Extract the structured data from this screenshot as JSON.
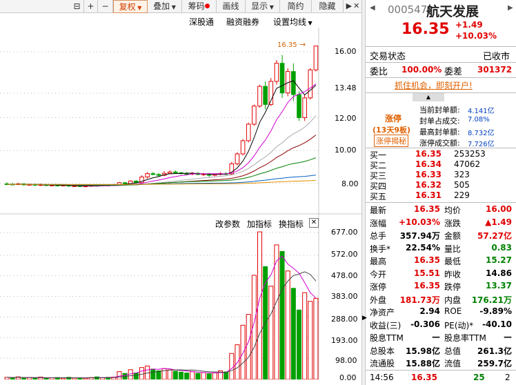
{
  "toolbar": {
    "lock": "⊟",
    "plus": "+",
    "minus": "−",
    "fuquan": "复权",
    "diejia": "叠加",
    "chouma": "筹码",
    "huaxian": "画线",
    "xianshi": "显示",
    "jianyue": "简约",
    "yincang": "隐藏",
    "nav": "▶",
    "close": "✕"
  },
  "chart": {
    "tabs": [
      "深股通",
      "融资融券",
      "设置均线"
    ],
    "price_marker": "16.35",
    "price_axis": [
      "16.00",
      "13.48",
      "12.00",
      "10.00",
      "8.00"
    ],
    "candles": [
      [
        7.98,
        7.96,
        8.08,
        7.9
      ],
      [
        7.96,
        7.95,
        8.05,
        7.9
      ],
      [
        7.95,
        7.98,
        8.05,
        7.9
      ],
      [
        7.98,
        7.92,
        8.02,
        7.88
      ],
      [
        7.92,
        7.94,
        8.0,
        7.88
      ],
      [
        7.94,
        7.9,
        8.0,
        7.85
      ],
      [
        7.9,
        7.93,
        8.0,
        7.85
      ],
      [
        7.93,
        7.88,
        7.98,
        7.84
      ],
      [
        7.88,
        7.9,
        7.95,
        7.85
      ],
      [
        7.9,
        7.86,
        7.94,
        7.82
      ],
      [
        7.86,
        7.9,
        7.96,
        7.82
      ],
      [
        7.9,
        7.85,
        7.95,
        7.8
      ],
      [
        7.85,
        7.86,
        7.92,
        7.8
      ],
      [
        7.86,
        7.82,
        7.9,
        7.78
      ],
      [
        7.82,
        7.85,
        7.9,
        7.78
      ],
      [
        7.85,
        7.88,
        7.94,
        7.8
      ],
      [
        7.88,
        7.86,
        7.92,
        7.82
      ],
      [
        7.86,
        7.9,
        7.96,
        7.84
      ],
      [
        7.9,
        7.88,
        7.95,
        7.85
      ],
      [
        7.88,
        7.92,
        7.98,
        7.85
      ],
      [
        7.92,
        8.05,
        8.1,
        7.9
      ],
      [
        8.05,
        8.0,
        8.1,
        7.95
      ],
      [
        8.0,
        8.15,
        8.2,
        7.98
      ],
      [
        8.15,
        8.05,
        8.2,
        8.0
      ],
      [
        8.05,
        8.4,
        8.5,
        8.02
      ],
      [
        8.4,
        8.6,
        8.7,
        8.3
      ],
      [
        8.6,
        8.55,
        8.7,
        8.5
      ],
      [
        8.55,
        8.5,
        8.65,
        8.4
      ],
      [
        8.5,
        8.62,
        8.75,
        8.45
      ],
      [
        8.62,
        8.7,
        8.8,
        8.6
      ],
      [
        8.7,
        8.65,
        8.8,
        8.6
      ],
      [
        8.65,
        8.6,
        8.7,
        8.55
      ],
      [
        8.6,
        8.58,
        8.7,
        8.5
      ],
      [
        8.58,
        8.62,
        8.7,
        8.5
      ],
      [
        8.62,
        8.55,
        8.7,
        8.5
      ],
      [
        8.55,
        8.58,
        8.65,
        8.45
      ],
      [
        8.58,
        8.5,
        8.65,
        8.4
      ],
      [
        8.5,
        8.56,
        8.6,
        8.45
      ],
      [
        8.56,
        8.6,
        8.7,
        8.5
      ],
      [
        8.6,
        8.58,
        8.7,
        8.5
      ],
      [
        8.58,
        9.2,
        9.3,
        8.5
      ],
      [
        9.2,
        9.8,
        9.9,
        9.1
      ],
      [
        9.8,
        10.6,
        10.7,
        9.7
      ],
      [
        10.6,
        11.6,
        11.7,
        10.5
      ],
      [
        11.6,
        12.7,
        12.8,
        11.5
      ],
      [
        12.7,
        13.9,
        14.0,
        12.6
      ],
      [
        13.9,
        12.8,
        14.2,
        12.5
      ],
      [
        12.8,
        14.2,
        14.4,
        12.7
      ],
      [
        14.2,
        15.3,
        15.5,
        14.0
      ],
      [
        15.3,
        13.5,
        15.8,
        13.2
      ],
      [
        13.5,
        14.8,
        15.0,
        13.3
      ],
      [
        14.8,
        13.4,
        15.3,
        13.0
      ],
      [
        13.4,
        12.0,
        13.6,
        11.8
      ],
      [
        12.0,
        13.2,
        13.4,
        11.8
      ],
      [
        13.2,
        14.9,
        15.0,
        13.1
      ],
      [
        14.9,
        16.35,
        16.35,
        14.8
      ]
    ],
    "volumes": [
      10,
      8,
      12,
      6,
      9,
      7,
      11,
      5,
      8,
      9,
      6,
      10,
      7,
      8,
      6,
      9,
      12,
      8,
      10,
      11,
      36,
      28,
      45,
      30,
      55,
      62,
      48,
      40,
      50,
      44,
      38,
      34,
      30,
      36,
      28,
      32,
      26,
      30,
      40,
      35,
      120,
      160,
      250,
      300,
      480,
      680,
      520,
      430,
      620,
      590,
      500,
      420,
      320,
      400,
      360,
      374
    ],
    "vol_dir": [
      1,
      -1,
      1,
      -1,
      1,
      -1,
      1,
      -1,
      1,
      -1,
      1,
      -1,
      1,
      -1,
      1,
      1,
      -1,
      1,
      -1,
      1,
      1,
      -1,
      1,
      -1,
      1,
      1,
      -1,
      -1,
      1,
      1,
      -1,
      -1,
      -1,
      1,
      -1,
      1,
      -1,
      1,
      1,
      -1,
      1,
      1,
      1,
      1,
      1,
      1,
      -1,
      1,
      1,
      -1,
      1,
      -1,
      -1,
      1,
      1,
      1
    ],
    "indicator_tabs": [
      "改参数",
      "加指标",
      "换指标"
    ],
    "vol_axis": [
      "677.00",
      "572.00",
      "478.00",
      "383.00",
      "288.00",
      "193.00",
      "98.00",
      "0.00"
    ]
  },
  "quote": {
    "code": "000547",
    "name": "航天发展",
    "price": "16.35",
    "change": "+1.49",
    "change_pct": "+10.03%"
  },
  "status": {
    "label": "交易状态",
    "value": "已收市"
  },
  "weibi": {
    "label1": "委比",
    "value1": "100.00%",
    "label2": "委差",
    "value2": "301372"
  },
  "banner": "抓住机会，即刻开户!",
  "limit": {
    "tag": "涨停",
    "days": "(13天9板)",
    "reveal": "涨停揭秘",
    "rows": [
      [
        "当前封单额:",
        "4.141亿"
      ],
      [
        "封单占成交:",
        "7.08%"
      ],
      [
        "最高封单额:",
        "8.732亿"
      ],
      [
        "涨停成交额:",
        "7.726亿"
      ]
    ]
  },
  "orderbook": [
    [
      "买一",
      "16.35",
      "253253"
    ],
    [
      "买二",
      "16.34",
      "47062"
    ],
    [
      "买三",
      "16.33",
      "323"
    ],
    [
      "买四",
      "16.32",
      "505"
    ],
    [
      "买五",
      "16.31",
      "229"
    ]
  ],
  "stats": [
    [
      "最新",
      "16.35",
      "均价",
      "16.00"
    ],
    [
      "涨幅",
      "+10.03%",
      "涨跌",
      "▲1.49"
    ],
    [
      "总手",
      "357.94万",
      "金额",
      "57.27亿"
    ],
    [
      "换手*",
      "22.54%",
      "量比",
      "0.83"
    ],
    [
      "最高",
      "16.35",
      "最低",
      "15.27"
    ],
    [
      "今开",
      "15.51",
      "昨收",
      "14.86"
    ],
    [
      "涨停",
      "16.35",
      "跌停",
      "13.37"
    ],
    [
      "外盘",
      "181.73万",
      "内盘",
      "176.21万"
    ],
    [
      "净资产",
      "2.94",
      "ROE",
      "-9.89%"
    ],
    [
      "收益(三)",
      "-0.306",
      "PE(动)*",
      "-40.10"
    ],
    [
      "股息TTM",
      "—",
      "股息率TTM",
      "—"
    ],
    [
      "总股本",
      "15.98亿",
      "总值",
      "261.3亿"
    ],
    [
      "流通股",
      "15.88亿",
      "流值",
      "259.7亿"
    ]
  ],
  "tick": {
    "time": "14:56",
    "price": "16.35",
    "vol": "25",
    "n": "2"
  }
}
